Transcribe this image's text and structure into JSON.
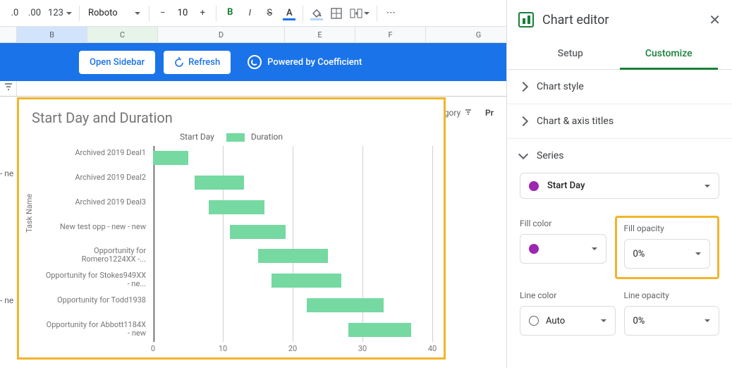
{
  "toolbar": {
    "decrease_decimal": ".0",
    "increase_decimal": ".00",
    "format_menu": "123",
    "font": "Roboto",
    "font_size": "10",
    "bold": "B",
    "italic": "I",
    "strike": "S",
    "text_color": "A",
    "more": "⋯"
  },
  "columns": [
    "B",
    "C",
    "D",
    "E",
    "F",
    "G"
  ],
  "blue_bar": {
    "open_sidebar": "Open Sidebar",
    "refresh": "Refresh",
    "powered": "Powered by Coefficient"
  },
  "filter_row": {
    "left1": "- ne",
    "left2": "- ne",
    "category": "ategory",
    "pr": "Pr"
  },
  "chart": {
    "title": "Start Day and Duration",
    "legend_a": "Start Day",
    "legend_b": "Duration",
    "y_title": "Task Name"
  },
  "chart_data": {
    "type": "bar",
    "orientation": "horizontal",
    "stacked": true,
    "categories": [
      "Archived 2019 Deal1",
      "Archived 2019 Deal2",
      "Archived 2019 Deal3",
      "New test opp - new - new",
      "Opportunity for Romero1224XX -...",
      "Opportunity for Stokes949XX - ne...",
      "Opportunity for Todd1938",
      "Opportunity for Abbott1184X - new"
    ],
    "series": [
      {
        "name": "Start Day",
        "values": [
          0,
          6,
          8,
          11,
          15,
          17,
          22,
          28
        ],
        "color_opacity": "0%"
      },
      {
        "name": "Duration",
        "values": [
          5,
          7,
          8,
          8,
          10,
          10,
          11,
          9
        ],
        "color": "#75d9a1"
      }
    ],
    "xlabel": "",
    "ylabel": "Task Name",
    "xlim": [
      0,
      40
    ],
    "xticks": [
      0,
      10,
      20,
      30,
      40
    ]
  },
  "panel": {
    "title": "Chart editor",
    "tab_setup": "Setup",
    "tab_customize": "Customize",
    "acc_chart_style": "Chart style",
    "acc_axis_titles": "Chart & axis titles",
    "acc_series": "Series",
    "series_selected": "Start Day",
    "fill_color_label": "Fill color",
    "fill_opacity_label": "Fill opacity",
    "fill_opacity_value": "0%",
    "line_color_label": "Line color",
    "line_color_value": "Auto",
    "line_opacity_label": "Line opacity",
    "line_opacity_value": "0%"
  }
}
